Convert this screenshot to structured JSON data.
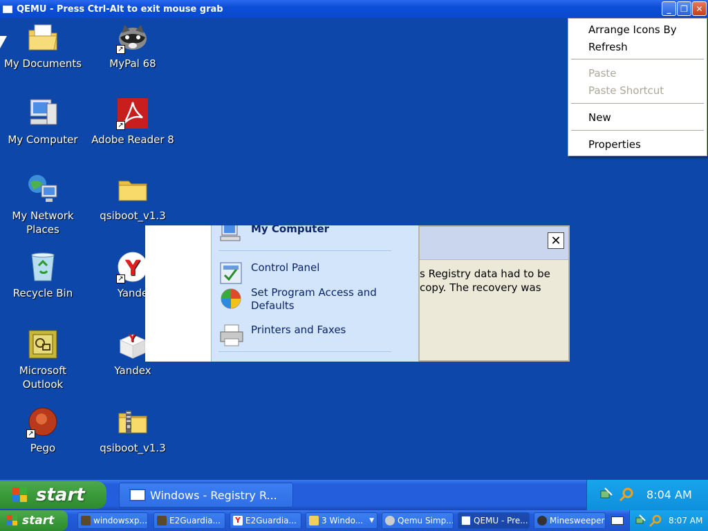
{
  "qemu": {
    "title": "QEMU - Press Ctrl-Alt to exit mouse grab",
    "minimize_icon": "minimize-icon",
    "restore_icon": "restore-icon",
    "close_icon": "close-icon"
  },
  "desktop": {
    "icons": [
      {
        "label": "My Documents",
        "icon": "my-documents-icon"
      },
      {
        "label": "MyPal 68",
        "icon": "mypal-raccoon-icon"
      },
      {
        "label": "My Computer",
        "icon": "my-computer-icon"
      },
      {
        "label": "Adobe Reader 8",
        "icon": "adobe-reader-icon"
      },
      {
        "label": "My Network Places",
        "icon": "network-places-icon"
      },
      {
        "label": "qsiboot_v1.3",
        "icon": "folder-icon"
      },
      {
        "label": "Recycle Bin",
        "icon": "recycle-bin-icon"
      },
      {
        "label": "Yande",
        "icon": "yandex-browser-icon"
      },
      {
        "label": "Microsoft Outlook",
        "icon": "outlook-icon"
      },
      {
        "label": "Yandex",
        "icon": "yandex-box-icon"
      },
      {
        "label": "Pego",
        "icon": "pego-icon"
      },
      {
        "label": "qsiboot_v1.3",
        "icon": "zip-folder-icon"
      }
    ]
  },
  "context_menu": {
    "arrange": "Arrange Icons By",
    "refresh": "Refresh",
    "paste": "Paste",
    "paste_shortcut": "Paste Shortcut",
    "new": "New",
    "properties": "Properties"
  },
  "start_menu": {
    "my_computer": "My Computer",
    "control_panel": "Control Panel",
    "set_program": "Set Program Access and Defaults",
    "printers": "Printers and Faxes"
  },
  "dialog": {
    "line1": "s Registry data had to be",
    "line2": "copy. The recovery was",
    "close": "✕"
  },
  "taskbar_inner": {
    "start": "start",
    "task_label": "Windows - Registry R...",
    "time": "8:04 AM"
  },
  "taskbar_outer": {
    "start": "start",
    "buttons": [
      {
        "label": "windowsxp..."
      },
      {
        "label": "E2Guardia..."
      },
      {
        "label": "E2Guardia..."
      },
      {
        "label": "3 Windo..."
      },
      {
        "label": "Qemu Simp..."
      },
      {
        "label": "QEMU - Pre..."
      },
      {
        "label": "Minesweeper"
      }
    ],
    "time": "8:07 AM"
  },
  "colors": {
    "desktop": "#0d47aa",
    "taskbar": "#245edc",
    "start_green": "#3a9a3a",
    "tray": "#0f90dd"
  }
}
